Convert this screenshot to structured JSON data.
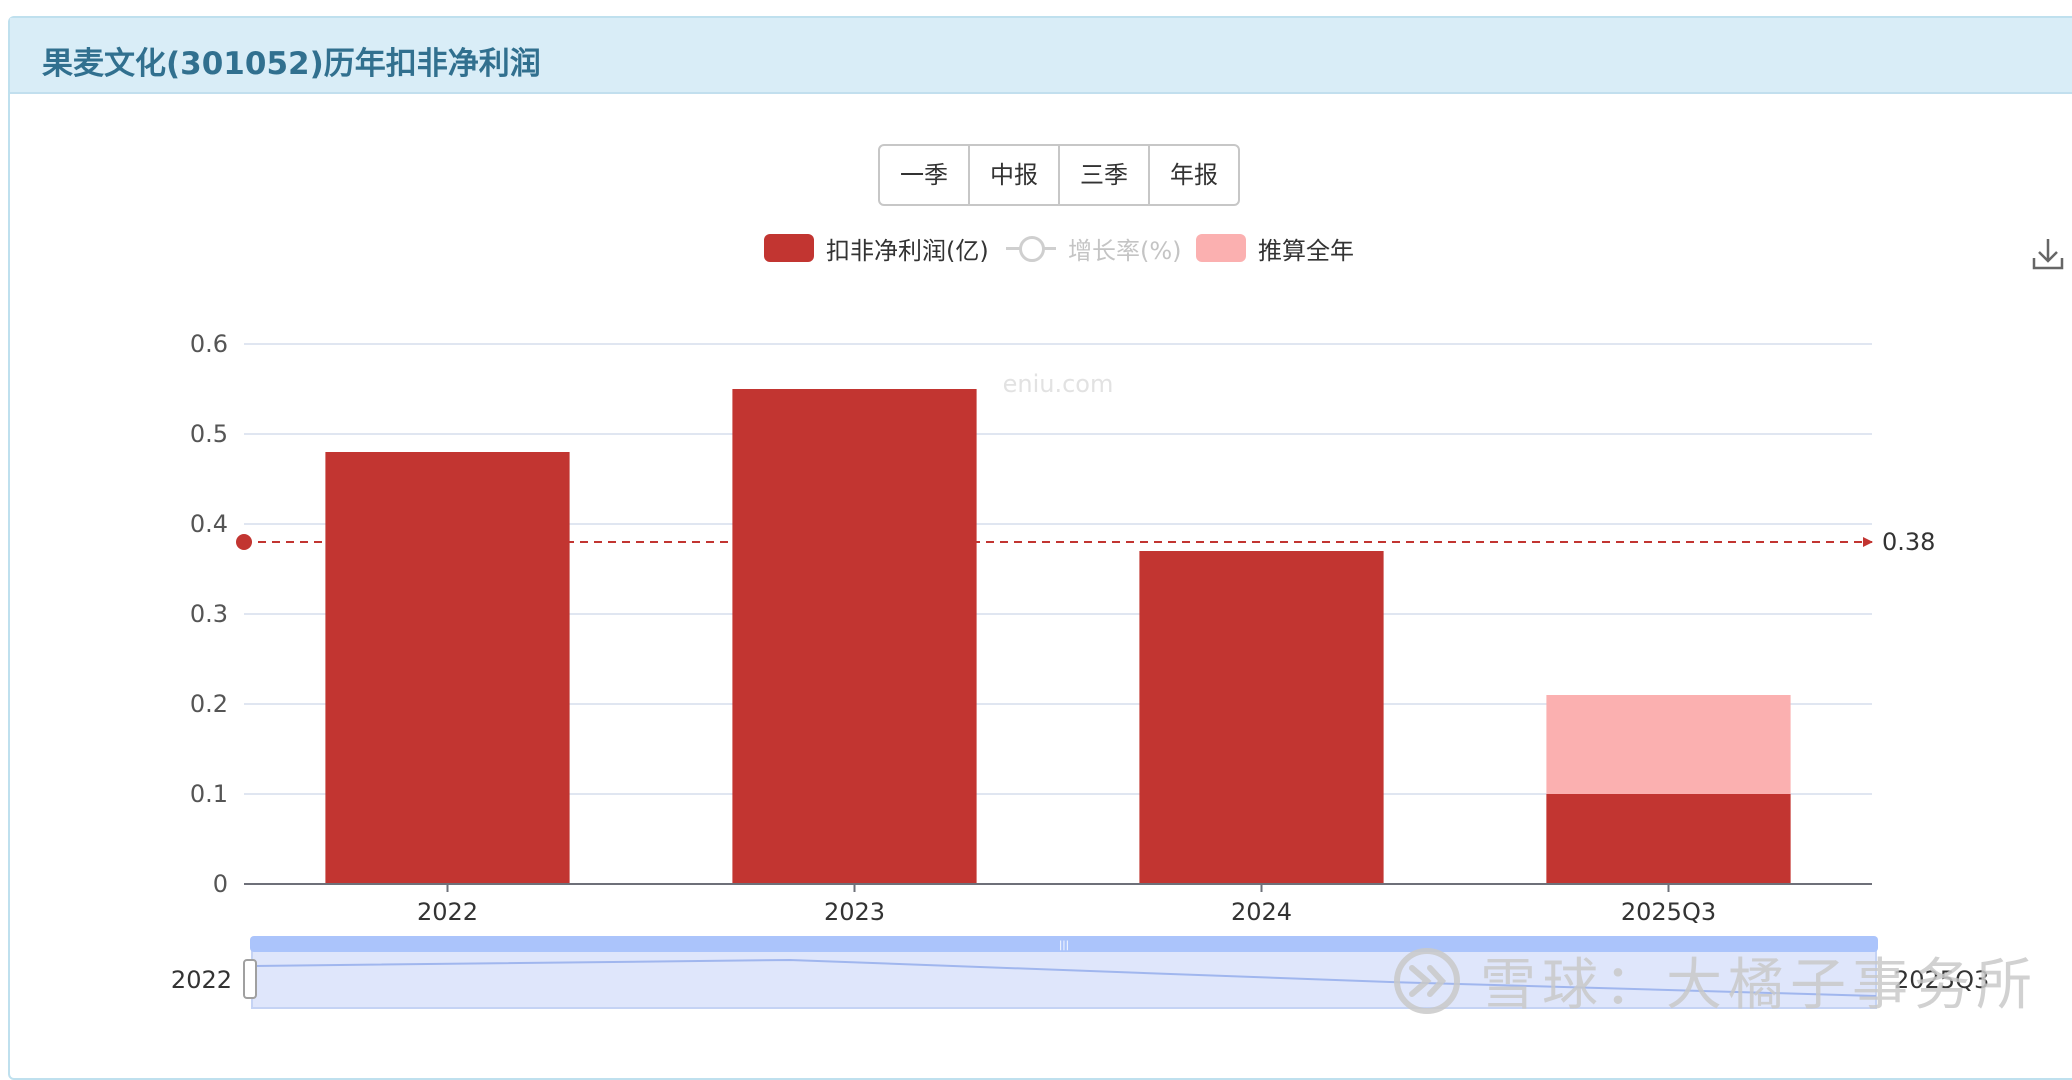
{
  "header": {
    "title": "果麦文化(301052)历年扣非净利润"
  },
  "period_buttons": [
    "一季",
    "中报",
    "三季",
    "年报"
  ],
  "legend": [
    {
      "label": "扣非净利润(亿)",
      "color": "#c23531",
      "type": "bar"
    },
    {
      "label": "增长率(%)",
      "color": "#cccccc",
      "type": "line",
      "inactive": true
    },
    {
      "label": "推算全年",
      "color": "#fbb0b0",
      "type": "bar"
    }
  ],
  "watermark": "eniu.com",
  "chart_data": {
    "type": "bar",
    "categories": [
      "2022",
      "2023",
      "2024",
      "2025Q3"
    ],
    "series": [
      {
        "name": "扣非净利润(亿)",
        "values": [
          0.48,
          0.55,
          0.37,
          0.1
        ],
        "color": "#c23531"
      },
      {
        "name": "推算全年",
        "values": [
          null,
          null,
          null,
          0.21
        ],
        "color": "#fbb0b0"
      }
    ],
    "ylim": [
      0,
      0.6
    ],
    "y_ticks": [
      "0",
      "0.1",
      "0.2",
      "0.3",
      "0.4",
      "0.5",
      "0.6"
    ],
    "average_line": {
      "value": 0.38,
      "label": "0.38",
      "color": "#c23531"
    },
    "grid": true,
    "legend_position": "top-center"
  },
  "data_zoom": {
    "start_label": "2022",
    "end_label": "2025Q3"
  },
  "overlay_watermark": {
    "text": "雪球：大橘子事务所"
  }
}
